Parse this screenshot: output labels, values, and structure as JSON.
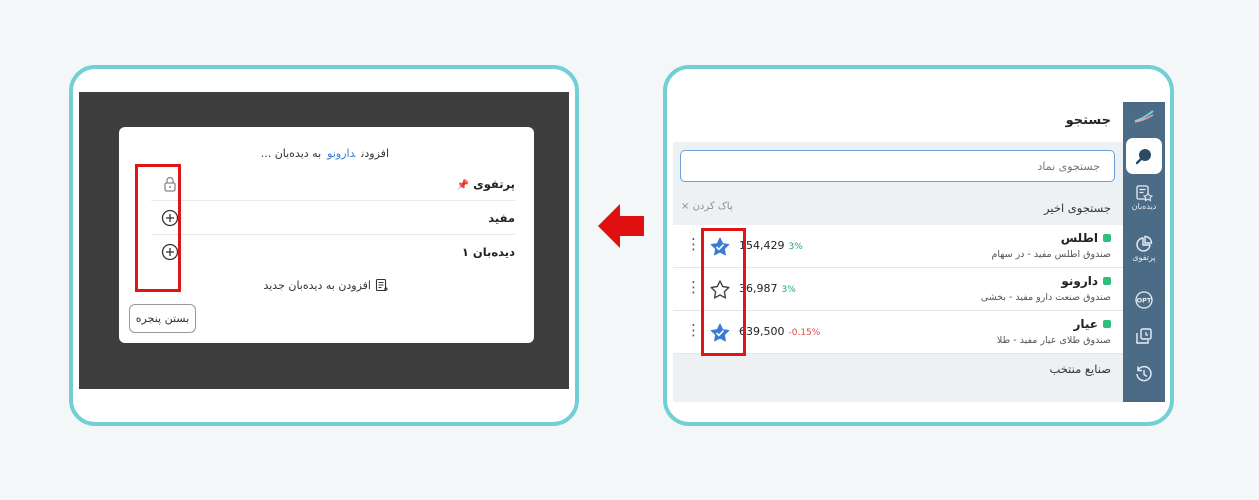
{
  "dialog": {
    "title_prefix": "افزودن",
    "title_symbol": "دارونو",
    "title_suffix": "به دیده‌بان ...",
    "watchlists": [
      {
        "name": "پرتفوی",
        "pinned": true,
        "action_icon": "lock-icon"
      },
      {
        "name": "مفید",
        "pinned": false,
        "action_icon": "plus-circle-icon"
      },
      {
        "name": "دیده‌بان ۱",
        "pinned": false,
        "action_icon": "plus-circle-icon"
      }
    ],
    "add_new_label": "افزودن به دیده‌بان جدید",
    "close_label": "بستن پنجره"
  },
  "panel": {
    "title": "جستجو",
    "search_placeholder": "جستجوی نماد",
    "recent_label": "جستجوی اخیر",
    "clear_label": "پاک کردن",
    "results": [
      {
        "symbol": "اطلس",
        "description": "صندوق اطلس مفید - در سهام",
        "price": "154,429",
        "change": "3%",
        "change_dir": "pos",
        "starred": true
      },
      {
        "symbol": "دارونو",
        "description": "صندوق صنعت دارو مفید - بخشی",
        "price": "36,987",
        "change": "3%",
        "change_dir": "pos",
        "starred": false
      },
      {
        "symbol": "عیار",
        "description": "صندوق طلای عیار مفید - طلا",
        "price": "639,500",
        "change": "-0.15%",
        "change_dir": "neg",
        "starred": true
      }
    ],
    "industries_label": "صنایع منتخب"
  },
  "sidebar": {
    "items": [
      {
        "icon": "logo-icon",
        "label": ""
      },
      {
        "icon": "search-icon",
        "label": ""
      },
      {
        "icon": "watchlist-icon",
        "label": "دیده‌بان"
      },
      {
        "icon": "portfolio-icon",
        "label": "پرتفوی"
      },
      {
        "icon": "opt-icon",
        "label": ""
      },
      {
        "icon": "orders-icon",
        "label": ""
      },
      {
        "icon": "history-icon",
        "label": ""
      }
    ]
  },
  "colors": {
    "frame": "#73cfd6",
    "sidebar": "#4c6b87",
    "highlight": "#e01515",
    "accent": "#3a7bd5",
    "positive": "#1fa86a",
    "negative": "#e04848"
  }
}
